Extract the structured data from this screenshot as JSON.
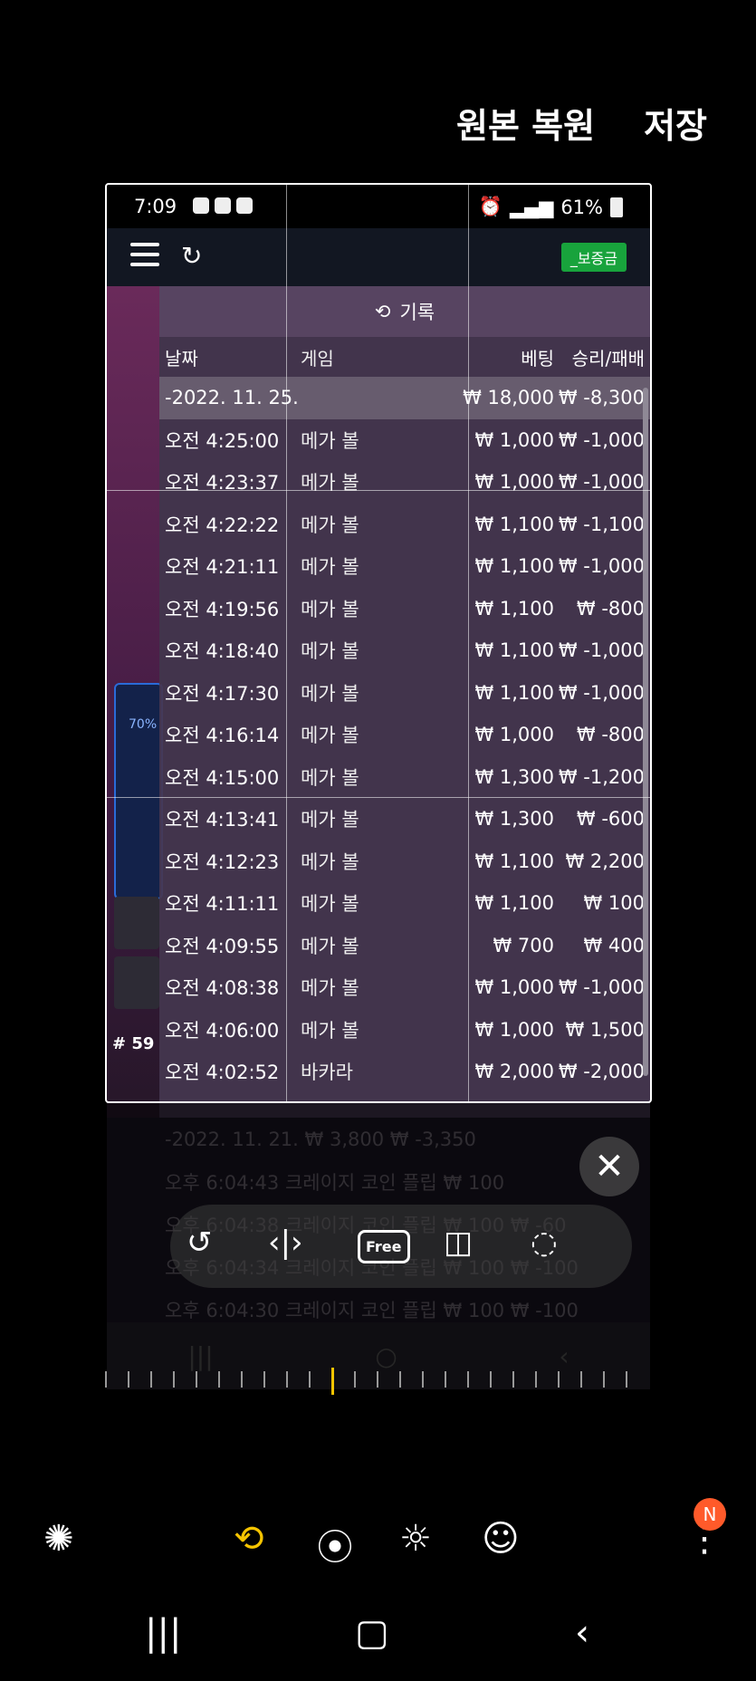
{
  "editor": {
    "restore_label": "원본 복원",
    "save_label": "저장",
    "free_label": "Free"
  },
  "status": {
    "time": "7:09",
    "battery": "61%"
  },
  "app": {
    "deposit_label": "_보증금",
    "side_percent": "70%",
    "round_label": "# 59"
  },
  "history": {
    "title": "기록",
    "columns": {
      "date": "날짜",
      "game": "게임",
      "bet": "베팅",
      "win_loss": "승리/패배"
    },
    "date_group": {
      "date": "-2022. 11. 25.",
      "bet": "₩ 18,000",
      "win_loss": "₩ -8,300"
    },
    "rows": [
      {
        "time": "오전 4:25:00",
        "game": "메가 볼",
        "bet": "₩ 1,000",
        "win_loss": "₩ -1,000"
      },
      {
        "time": "오전 4:23:37",
        "game": "메가 볼",
        "bet": "₩ 1,000",
        "win_loss": "₩ -1,000"
      },
      {
        "time": "오전 4:22:22",
        "game": "메가 볼",
        "bet": "₩ 1,100",
        "win_loss": "₩ -1,100"
      },
      {
        "time": "오전 4:21:11",
        "game": "메가 볼",
        "bet": "₩ 1,100",
        "win_loss": "₩ -1,000"
      },
      {
        "time": "오전 4:19:56",
        "game": "메가 볼",
        "bet": "₩ 1,100",
        "win_loss": "₩ -800"
      },
      {
        "time": "오전 4:18:40",
        "game": "메가 볼",
        "bet": "₩ 1,100",
        "win_loss": "₩ -1,000"
      },
      {
        "time": "오전 4:17:30",
        "game": "메가 볼",
        "bet": "₩ 1,100",
        "win_loss": "₩ -1,000"
      },
      {
        "time": "오전 4:16:14",
        "game": "메가 볼",
        "bet": "₩ 1,000",
        "win_loss": "₩ -800"
      },
      {
        "time": "오전 4:15:00",
        "game": "메가 볼",
        "bet": "₩ 1,300",
        "win_loss": "₩ -1,200"
      },
      {
        "time": "오전 4:13:41",
        "game": "메가 볼",
        "bet": "₩ 1,300",
        "win_loss": "₩ -600"
      },
      {
        "time": "오전 4:12:23",
        "game": "메가 볼",
        "bet": "₩ 1,100",
        "win_loss": "₩ 2,200"
      },
      {
        "time": "오전 4:11:11",
        "game": "메가 볼",
        "bet": "₩ 1,100",
        "win_loss": "₩ 100"
      },
      {
        "time": "오전 4:09:55",
        "game": "메가 볼",
        "bet": "₩ 700",
        "win_loss": "₩ 400"
      },
      {
        "time": "오전 4:08:38",
        "game": "메가 볼",
        "bet": "₩ 1,000",
        "win_loss": "₩ -1,000"
      },
      {
        "time": "오전 4:06:00",
        "game": "메가 볼",
        "bet": "₩ 1,000",
        "win_loss": "₩ 1,500"
      },
      {
        "time": "오전 4:02:52",
        "game": "바카라",
        "bet": "₩ 2,000",
        "win_loss": "₩ -2,000"
      }
    ],
    "outside_rows": [
      {
        "text": "-2022. 11. 21.   ₩ 3,800  ₩ -3,350"
      },
      {
        "text": "오후 6:04:43  크레이지 코인 플립  ₩ 100"
      },
      {
        "text": "오후 6:04:38  크레이지 코인 플립  ₩ 100  ₩ -60"
      },
      {
        "text": "오후 6:04:34  크레이지 코인 플립  ₩ 100  ₩ -100"
      },
      {
        "text": "오후 6:04:30  크레이지 코인 플립  ₩ 100  ₩ -100"
      }
    ]
  },
  "bottom": {
    "notification_badge": "N"
  }
}
